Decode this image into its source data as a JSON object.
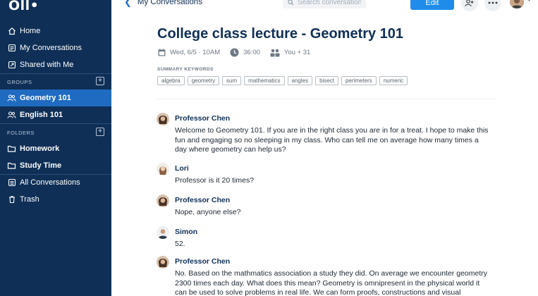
{
  "sidebar": {
    "logo": "Oll•",
    "items": [
      {
        "label": "Home",
        "icon": "home-icon"
      },
      {
        "label": "My Conversations",
        "icon": "conversations-icon"
      },
      {
        "label": "Shared with Me",
        "icon": "shared-icon"
      }
    ],
    "groups_label": "GROUPS",
    "groups": [
      {
        "label": "Geometry 101",
        "icon": "group-icon",
        "active": true
      },
      {
        "label": "English 101",
        "icon": "group-icon",
        "active": false
      }
    ],
    "folders_label": "FOLDERS",
    "folders": [
      {
        "label": "Homework",
        "icon": "folder-icon"
      },
      {
        "label": "Study Time",
        "icon": "folder-icon"
      }
    ],
    "bottom": [
      {
        "label": "All Conversations",
        "icon": "all-conversations-icon"
      },
      {
        "label": "Trash",
        "icon": "trash-icon"
      }
    ],
    "plus": "+"
  },
  "header": {
    "back_label": "My Conversations",
    "search_placeholder": "Search conversation",
    "edit_label": "Edit"
  },
  "conversation": {
    "title": "College class lecture - Geometry 101",
    "date": "Wed, 6/5 · 10AM",
    "duration": "36:00",
    "participants": "You + 31",
    "keywords_label": "SUMMARY KEYWORDS",
    "keywords": [
      "algebra",
      "geometry",
      "sum",
      "mathematics",
      "angles",
      "bisect",
      "perimeters",
      "numeric"
    ]
  },
  "messages": [
    {
      "speaker": "Professor Chen",
      "text": "Welcome to Geometry 101. If you are in the right class you are in for a treat. I hope to make this fun and engaging so no sleeping in my class. Who can tell me on average how many times a day where geometry can help us?"
    },
    {
      "speaker": "Lori",
      "text": "Professor is it 20 times?"
    },
    {
      "speaker": "Professor Chen",
      "text": "Nope, anyone else?"
    },
    {
      "speaker": "Simon",
      "text": "52."
    },
    {
      "speaker": "Professor Chen",
      "text": "No. Based on the mathmatics association a study they did. On average we encounter geometry 2300 times each day.  What does this mean? Geometry is omnipresent in the physical world it can be used to solve problems in real life. We can form proofs, constructions and visual observations to demonstrate"
    }
  ],
  "colors": {
    "sidebar_bg": "#0f2f56",
    "active_item": "#1f6bc1",
    "accent": "#1f8ceb"
  }
}
